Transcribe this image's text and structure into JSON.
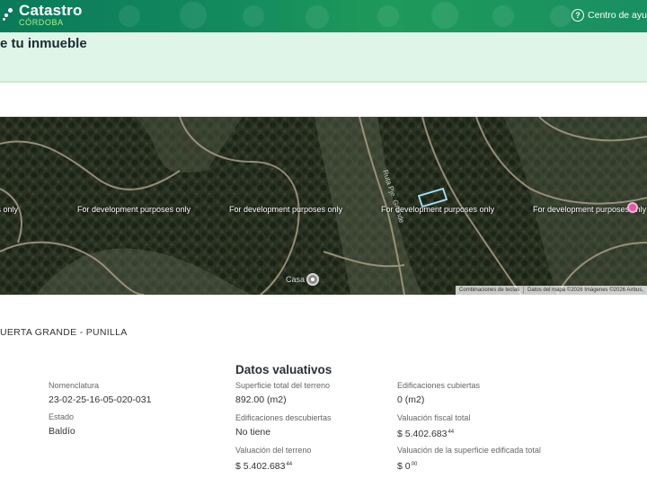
{
  "header": {
    "app_title": "Catastro",
    "app_subtitle": "CÓRDOBA",
    "help_label": "Centro de ayu"
  },
  "page": {
    "title": "e tu inmueble"
  },
  "map": {
    "watermarks": [
      "rposes only",
      "For development purposes only",
      "For development purposes only",
      "For development purposes only",
      "For development purposes only"
    ],
    "road_label": "Ruta Pje. Grande",
    "poi_label": "Casa",
    "attribution_shortcuts": "Combinaciones de teclas",
    "attribution_data": "Datos del mapa ©2026 Imágenes ©2026 Airbus,"
  },
  "location": "UERTA GRANDE - PUNILLA",
  "details": {
    "section_title": "Datos valuativos",
    "nomenclatura": {
      "label": "Nomenclatura",
      "value": "23-02-25-16-05-020-031"
    },
    "estado": {
      "label": "Estado",
      "value": "Baldío"
    },
    "superficie_total": {
      "label": "Superficie total del terreno",
      "value": "892.00 (m2)"
    },
    "edif_descubiertas": {
      "label": "Edificaciones descubiertas",
      "value": "No tiene"
    },
    "valuacion_terreno": {
      "label": "Valuación del terreno",
      "value": "$ 5.402.683",
      "cents": "44"
    },
    "edif_cubiertas": {
      "label": "Edificaciones cubiertas",
      "value": "0 (m2)"
    },
    "valuacion_fiscal": {
      "label": "Valuación fiscal total",
      "value": "$ 5.402.683",
      "cents": "44"
    },
    "valuacion_edificada": {
      "label": "Valuación de la superficie edificada total",
      "value": "$ 0",
      "cents": "00"
    }
  }
}
